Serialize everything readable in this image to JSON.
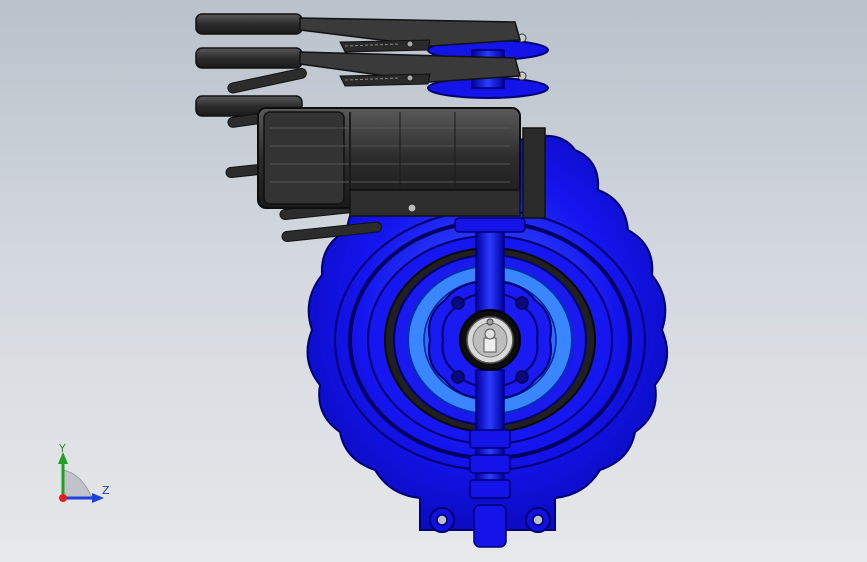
{
  "viewport": {
    "background_top": "#b9c1cb",
    "background_bottom": "#e6e8ea"
  },
  "colors": {
    "valve_blue": "#1010e8",
    "valve_blue_light": "#3a7cff",
    "valve_edge": "#00008a",
    "handle_dark": "#2b2b2b",
    "handle_mid": "#4a4a4a",
    "disc_gray": "#c8c8c8"
  },
  "triad": {
    "y_label": "Y",
    "z_label": "Z",
    "icon": "coordinate-triad-icon"
  }
}
